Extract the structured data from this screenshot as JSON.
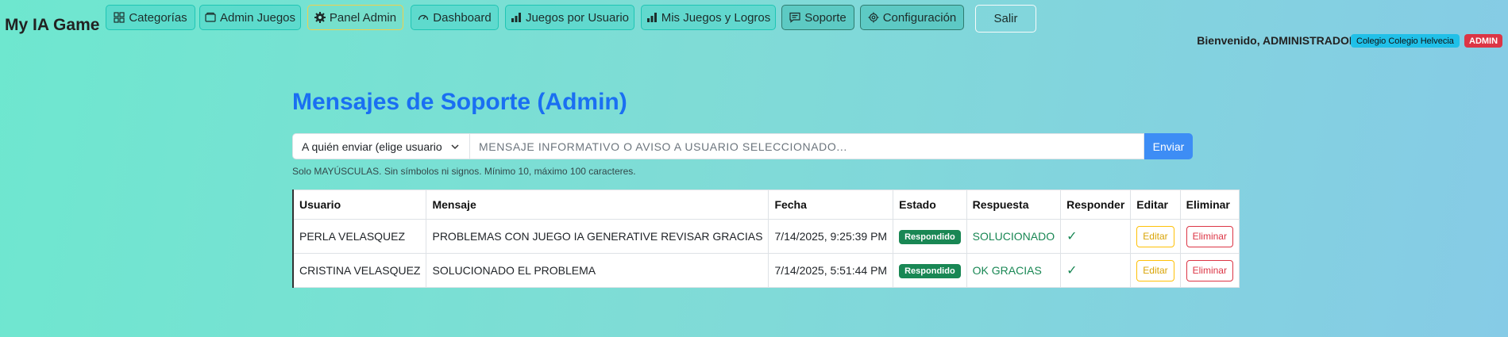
{
  "brand": "My IA Game",
  "nav": [
    {
      "label": "Categorías",
      "icon": "grid-icon"
    },
    {
      "label": "Admin Juegos",
      "icon": "wallet-icon"
    },
    {
      "label": "Panel Admin",
      "icon": "gear-fill-icon"
    },
    {
      "label": "Dashboard",
      "icon": "speedometer-icon"
    },
    {
      "label": "Juegos por Usuario",
      "icon": "bar-chart-icon"
    },
    {
      "label": "Mis Juegos y Logros",
      "icon": "bar-chart-icon"
    },
    {
      "label": "Soporte",
      "icon": "chat-icon"
    },
    {
      "label": "Configuración",
      "icon": "gear-icon"
    },
    {
      "label": "Salir",
      "icon": ""
    }
  ],
  "user": {
    "welcome": "Bienvenido, ADMINISTRADOR",
    "school_badge": "Colegio Colegio Helvecia",
    "role_badge": "ADMIN"
  },
  "page": {
    "title": "Mensajes de Soporte (Admin)",
    "recipient_select": "A quién enviar (elige usuario",
    "message_placeholder": "MENSAJE INFORMATIVO O AVISO A USUARIO SELECCIONADO...",
    "send_label": "Enviar",
    "hint": "Solo MAYÚSCULAS. Sin símbolos ni signos. Mínimo 10, máximo 100 caracteres."
  },
  "table": {
    "headers": [
      "Usuario",
      "Mensaje",
      "Fecha",
      "Estado",
      "Respuesta",
      "Responder",
      "Editar",
      "Eliminar"
    ],
    "rows": [
      {
        "usuario": "PERLA VELASQUEZ",
        "mensaje": "PROBLEMAS CON JUEGO IA GENERATIVE REVISAR GRACIAS",
        "fecha": "7/14/2025, 9:25:39 PM",
        "estado": "Respondido",
        "respuesta": "SOLUCIONADO",
        "responder": "✓",
        "editar": "Editar",
        "eliminar": "Eliminar"
      },
      {
        "usuario": "CRISTINA VELASQUEZ",
        "mensaje": "SOLUCIONADO EL PROBLEMA",
        "fecha": "7/14/2025, 5:51:44 PM",
        "estado": "Respondido",
        "respuesta": "OK GRACIAS",
        "responder": "✓",
        "editar": "Editar",
        "eliminar": "Eliminar"
      }
    ]
  },
  "colors": {
    "accent": "#1a6ff2",
    "success": "#198754",
    "danger": "#dc3545",
    "warning": "#ffc107",
    "info": "#20c0e8"
  }
}
